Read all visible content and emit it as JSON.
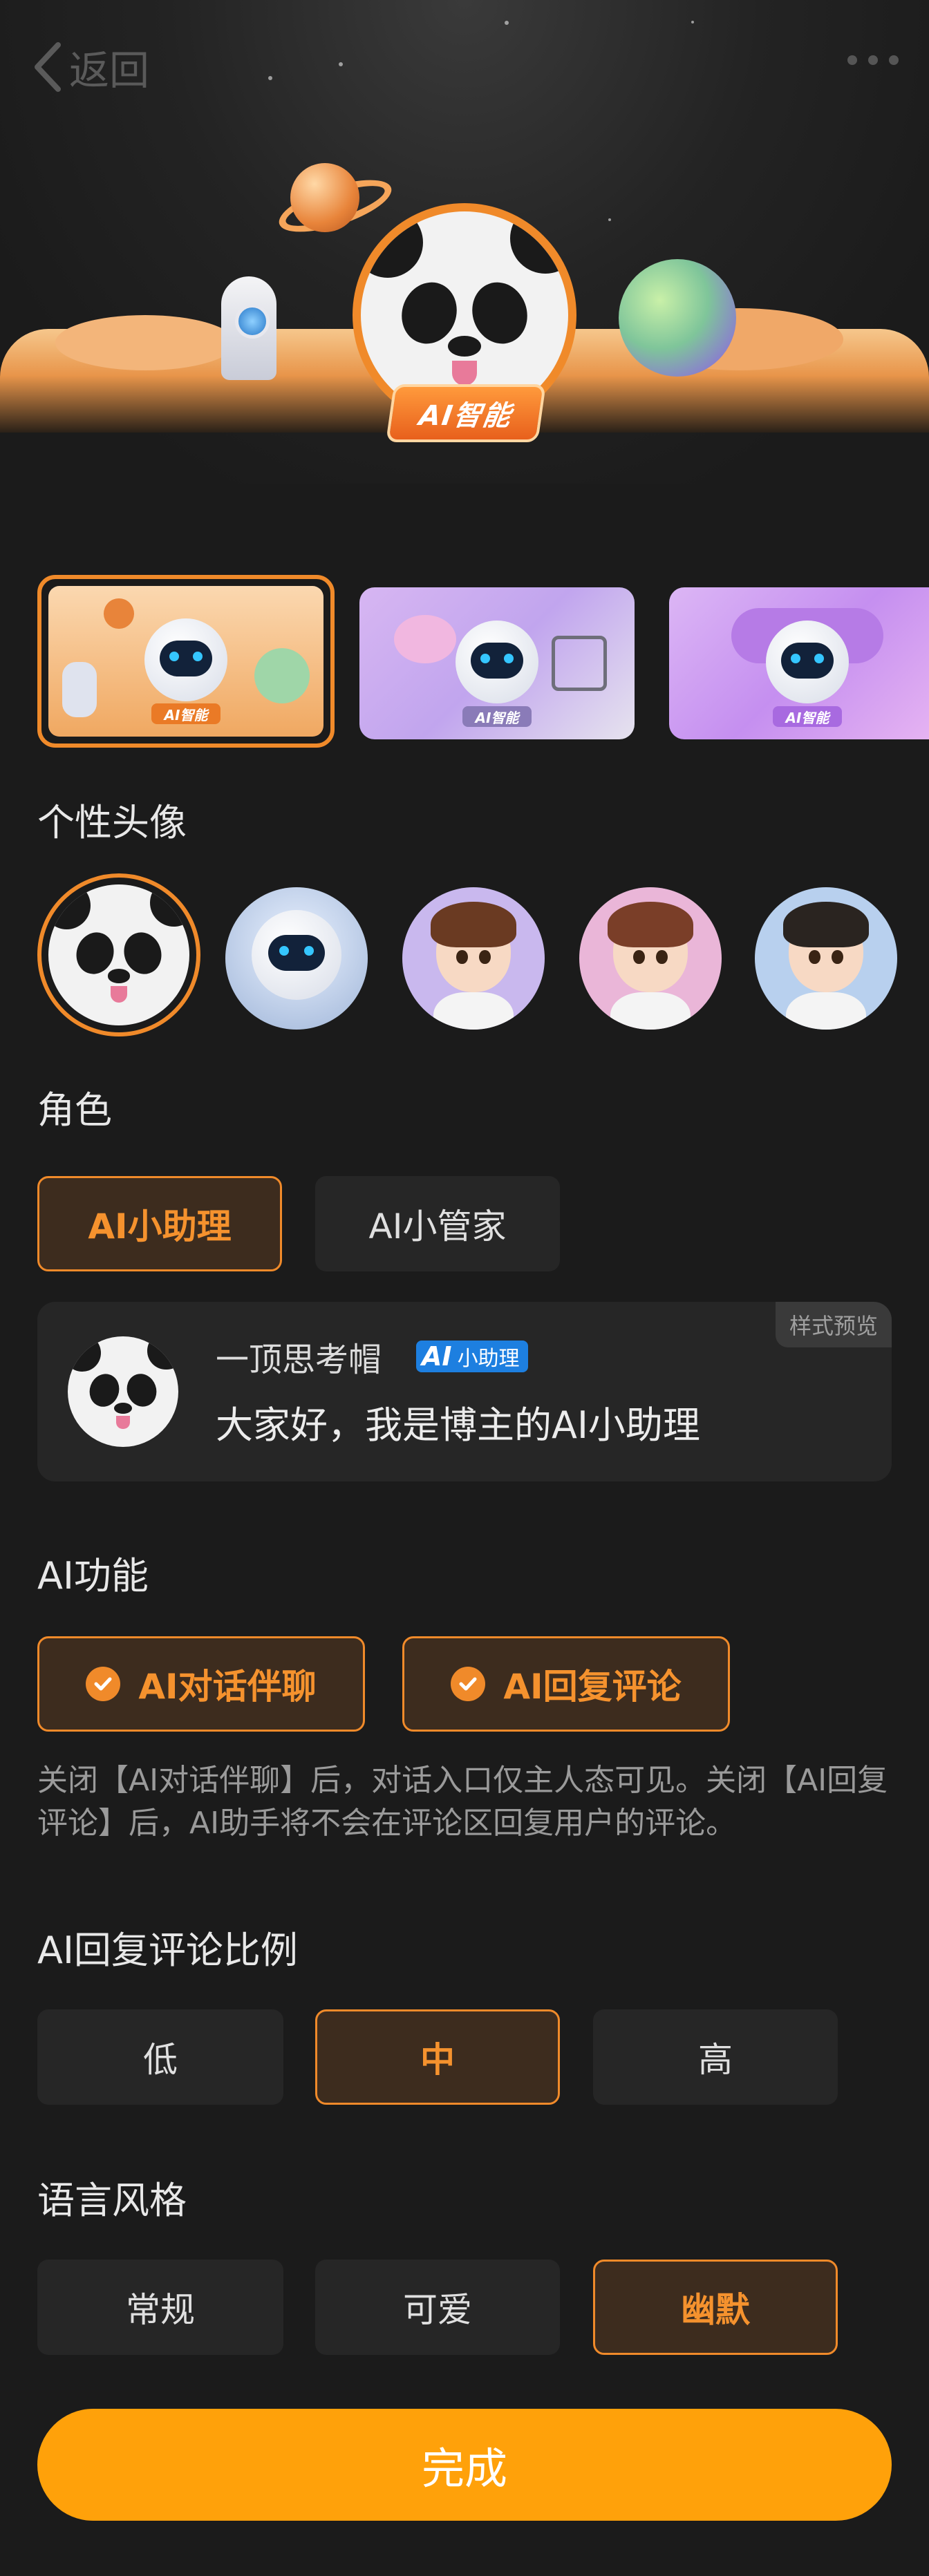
{
  "header": {
    "back_label": "返回",
    "hero_badge": "AI智能"
  },
  "themes": [
    {
      "badge": "AI智能",
      "accent": "#f08a2a",
      "selected": true
    },
    {
      "badge": "AI智能",
      "accent": "#8a7bb8",
      "selected": false
    },
    {
      "badge": "AI智能",
      "accent": "#a86ae0",
      "selected": false
    }
  ],
  "avatar_section": {
    "title": "个性头像",
    "items": [
      "panda",
      "robot",
      "boy",
      "girl",
      "young-man"
    ],
    "selected_index": 0
  },
  "role_section": {
    "title": "角色",
    "options": [
      "AI小助理",
      "AI小管家"
    ],
    "selected_index": 0
  },
  "preview": {
    "tag": "样式预览",
    "name": "一顶思考帽",
    "badge_icon": "AI",
    "badge_text": "小助理",
    "message": "大家好，我是博主的AI小助理"
  },
  "feature_section": {
    "title": "AI功能",
    "options": [
      "AI对话伴聊",
      "AI回复评论"
    ],
    "checked": [
      true,
      true
    ],
    "note": "关闭【AI对话伴聊】后，对话入口仅主人态可见。关闭【AI回复评论】后，AI助手将不会在评论区回复用户的评论。"
  },
  "ratio_section": {
    "title": "AI回复评论比例",
    "options": [
      "低",
      "中",
      "高"
    ],
    "selected_index": 1
  },
  "style_section": {
    "title": "语言风格",
    "options": [
      "常规",
      "可爱",
      "幽默"
    ],
    "selected_index": 2
  },
  "footer": {
    "done_label": "完成"
  },
  "colors": {
    "accent": "#f08a2a",
    "done_button": "#ffa10a",
    "background": "#1b1b1b"
  }
}
